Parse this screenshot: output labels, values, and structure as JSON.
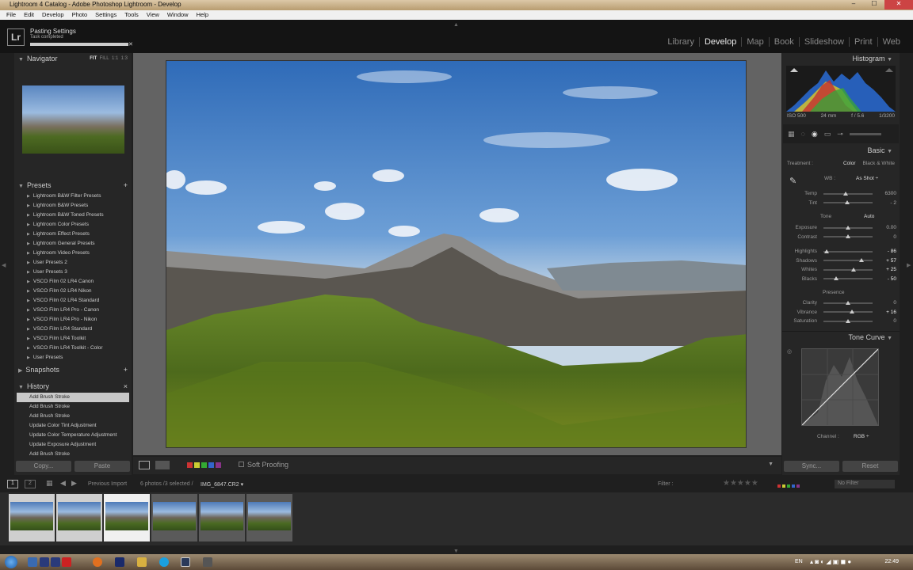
{
  "window": {
    "title": "Lightroom 4 Catalog - Adobe Photoshop Lightroom - Develop"
  },
  "menu": [
    "File",
    "Edit",
    "Develop",
    "Photo",
    "Settings",
    "Tools",
    "View",
    "Window",
    "Help"
  ],
  "task": {
    "title": "Pasting Settings",
    "status": "Task completed",
    "progress": 1.0
  },
  "modules": [
    "Library",
    "Develop",
    "Map",
    "Book",
    "Slideshow",
    "Print",
    "Web"
  ],
  "active_module": "Develop",
  "navigator": {
    "title": "Navigator",
    "opts": [
      "FIT",
      "FILL",
      "1:1",
      "1:3"
    ]
  },
  "presets": {
    "title": "Presets",
    "add": "+",
    "items": [
      "Lightroom B&W Filter Presets",
      "Lightroom B&W Presets",
      "Lightroom B&W Toned Presets",
      "Lightroom Color Presets",
      "Lightroom Effect Presets",
      "Lightroom General Presets",
      "Lightroom Video Presets",
      "User Presets 2",
      "User Presets 3",
      "VSCO Film 02 LR4 Canon",
      "VSCO Film 02 LR4 Nikon",
      "VSCO Film 02 LR4 Standard",
      "VSCO Film LR4 Pro - Canon",
      "VSCO Film LR4 Pro - Nikon",
      "VSCO Film LR4 Standard",
      "VSCO Film LR4 Toolkit",
      "VSCO Film LR4 Toolkit - Color",
      "User Presets"
    ]
  },
  "snapshots": {
    "title": "Snapshots",
    "add": "+"
  },
  "history": {
    "title": "History",
    "close": "×",
    "items": [
      "Add Brush Stroke",
      "Add Brush Stroke",
      "Add Brush Stroke",
      "Update Color Tint Adjustment",
      "Update Color Temperature Adjustment",
      "Update Exposure Adjustment",
      "Add Brush Stroke"
    ]
  },
  "leftbuttons": {
    "copy": "Copy...",
    "paste": "Paste"
  },
  "toolbar": {
    "softproof": "Soft Proofing"
  },
  "histogram": {
    "title": "Histogram",
    "iso": "ISO 500",
    "focal": "24 mm",
    "aperture": "f / 5.6",
    "shutter": "1/3200"
  },
  "basic": {
    "title": "Basic",
    "treatment": "Treatment :",
    "color": "Color",
    "bw": "Black & White",
    "wb_label": "WB :",
    "wb_value": "As Shot ÷",
    "tone": "Tone",
    "auto": "Auto",
    "presence": "Presence",
    "sliders": [
      {
        "label": "Temp",
        "value": "6300",
        "pos": 0.45
      },
      {
        "label": "Tint",
        "value": "- 2",
        "pos": 0.49
      },
      {
        "label": "Exposure",
        "value": "0.00",
        "pos": 0.5
      },
      {
        "label": "Contrast",
        "value": "0",
        "pos": 0.5
      },
      {
        "label": "Highlights",
        "value": "- 86",
        "pos": 0.07
      },
      {
        "label": "Shadows",
        "value": "+ 57",
        "pos": 0.78
      },
      {
        "label": "Whites",
        "value": "+ 25",
        "pos": 0.62
      },
      {
        "label": "Blacks",
        "value": "- 50",
        "pos": 0.25
      },
      {
        "label": "Clarity",
        "value": "0",
        "pos": 0.5
      },
      {
        "label": "Vibrance",
        "value": "+ 16",
        "pos": 0.58
      },
      {
        "label": "Saturation",
        "value": "0",
        "pos": 0.5
      }
    ]
  },
  "tonecurve": {
    "title": "Tone Curve",
    "channel_label": "Channel :",
    "channel": "RGB ÷"
  },
  "rightbuttons": {
    "sync": "Sync...",
    "reset": "Reset"
  },
  "filmbar": {
    "page1": "1",
    "page2": "2",
    "source": "Previous Import",
    "count": "6 photos /3 selected /",
    "file": "IMG_6847.CR2 ▾",
    "filter_label": "Filter :",
    "filter_value": "No Filter"
  },
  "taskbar": {
    "lang": "EN",
    "time": "22:49"
  }
}
